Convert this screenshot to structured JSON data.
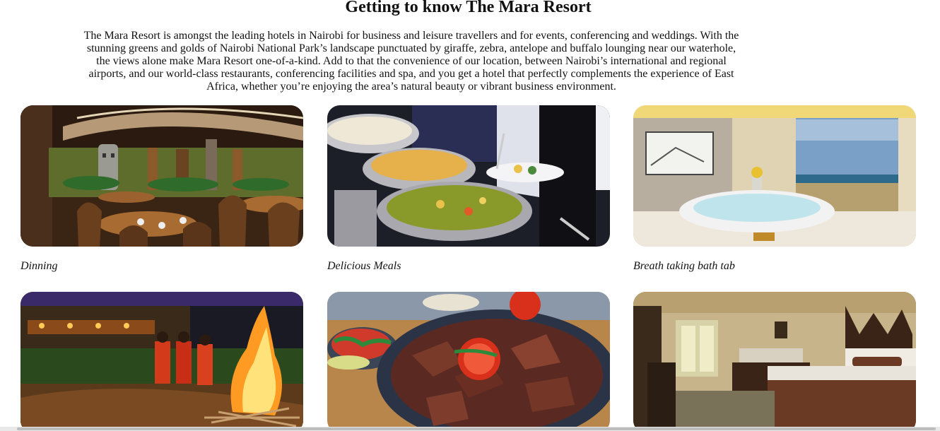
{
  "page": {
    "title": "Getting to know The Mara Resort",
    "intro": "The Mara Resort is amongst the leading hotels in Nairobi for business and leisure travellers and for events, conferencing and weddings. With the stunning greens and golds of Nairobi National Park’s landscape punctuated by giraffe, zebra, antelope and buffalo lounging near our waterhole, the views alone make Mara Resort one-of-a-kind. Add to that the convenience of our location, between Nairobi’s international and regional airports, and our world-class restaurants, conferencing facilities and spa, and you get a hotel that perfectly complements the experience of East Africa, whether you’re enjoying the area’s natural beauty or vibrant business environment."
  },
  "gallery": {
    "items": [
      {
        "caption": "Dinning",
        "photo": "restaurant-dining-room"
      },
      {
        "caption": "Delicious Meals",
        "photo": "buffet-serving"
      },
      {
        "caption": "Breath taking bath tab",
        "photo": "jacuzzi-bath-tub"
      },
      {
        "caption": "",
        "photo": "maasai-bonfire-night"
      },
      {
        "caption": "",
        "photo": "nyama-choma-platter"
      },
      {
        "caption": "",
        "photo": "hotel-bedroom"
      }
    ]
  }
}
